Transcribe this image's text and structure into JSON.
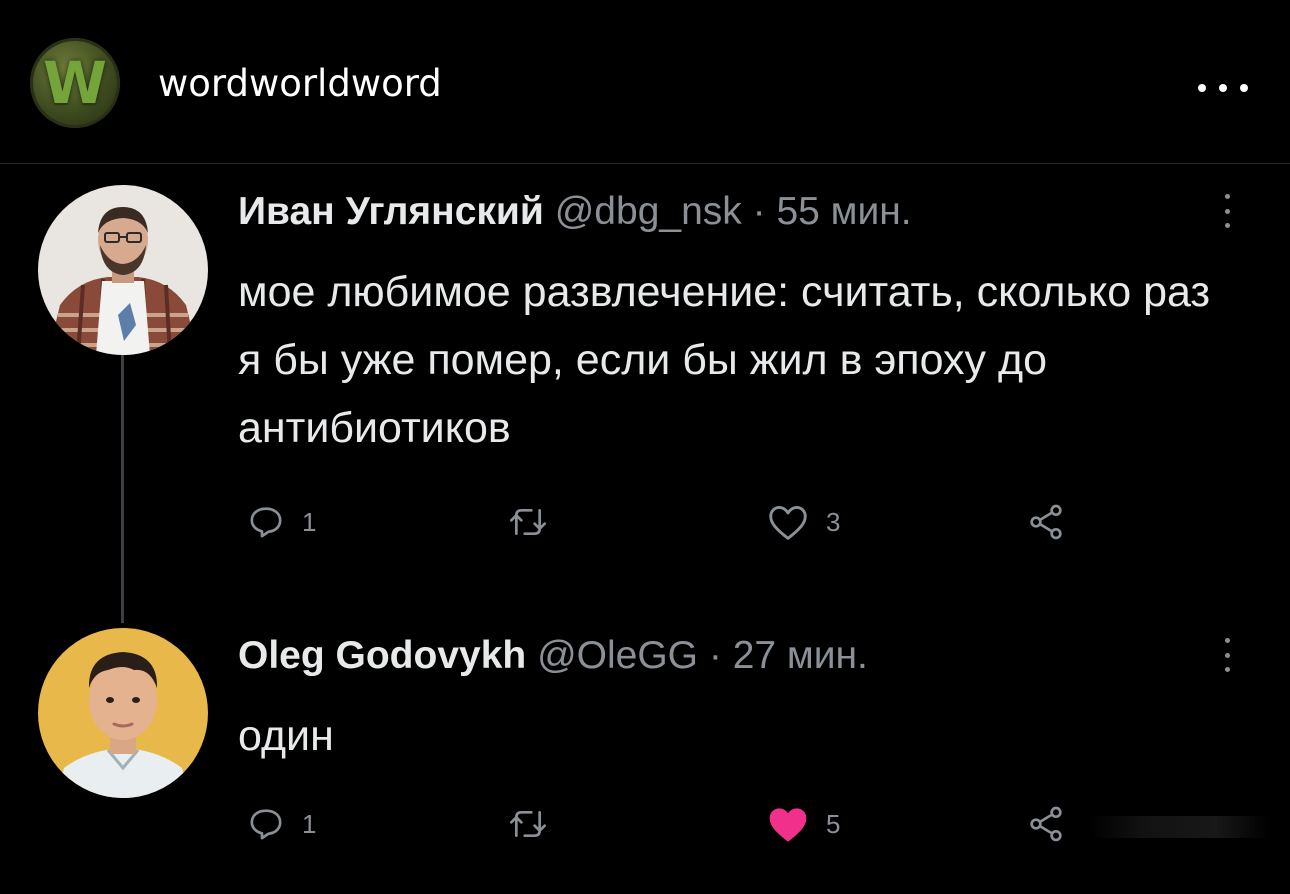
{
  "post": {
    "account_name": "wordworldword",
    "avatar_letter": "W",
    "more_icon": "more-horizontal-icon"
  },
  "tweets": [
    {
      "author_name": "Иван Углянский",
      "handle": "@dbg_nsk",
      "separator": "·",
      "time": "55 мин.",
      "text": "мое любимое развлечение: считать, сколько раз я бы уже помер, если бы жил в эпоху до антибиотиков",
      "reply_count": "1",
      "retweet_count": "",
      "like_count": "3",
      "liked": false
    },
    {
      "author_name": "Oleg Godovykh",
      "handle": "@OleGG",
      "separator": "·",
      "time": "27 мин.",
      "text": "один",
      "reply_count": "1",
      "retweet_count": "",
      "like_count": "5",
      "liked": true
    }
  ],
  "colors": {
    "background": "#000000",
    "text": "#e7e9ea",
    "muted": "#8b9096",
    "like_active": "#f0308a",
    "avatar_green": "#74a43a"
  }
}
